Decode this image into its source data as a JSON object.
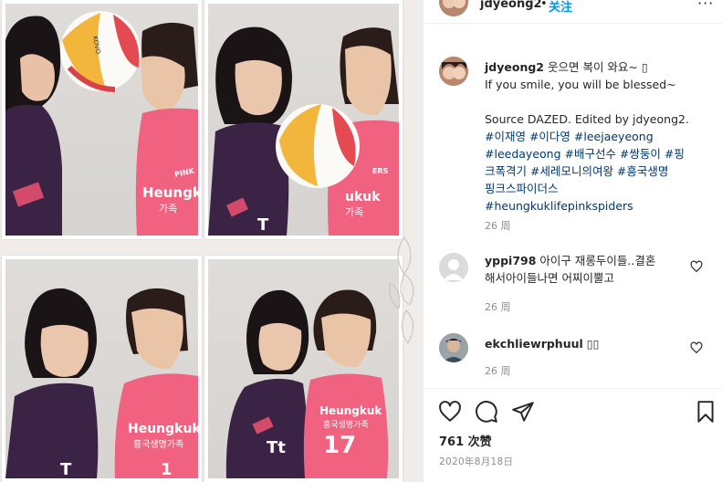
{
  "post": {
    "username": "jdyeong2",
    "separator": "•",
    "follow_label": "关注",
    "more_label": "···"
  },
  "caption": {
    "username": "jdyeong2",
    "line1": "웃으면 복이 와요~ ▯",
    "line2": "If you smile, you will be blessed~",
    "line3": "Source DAZED. Edited by jdyeong2.",
    "hashtags": [
      "#이재영",
      "#이다영",
      "#leejaeyeong",
      "#leedayeong",
      "#배구선수",
      "#쌍둥이",
      "#핑크폭격기",
      "#세레모니의여왕",
      "#흥국생명핑크스파이더스",
      "#heungkuklifepinkspiders"
    ],
    "tag_lines": [
      "#이재영 #이다영 #leejaeyeong",
      "#leedayeong #배구선수 #쌍둥이 #핑",
      "크폭격기 #세레모니의여왕 #흥국생명",
      "핑크스파이더스",
      "#heungkuklifepinkspiders"
    ],
    "time": "26 周"
  },
  "comments": [
    {
      "username": "yppi798",
      "text_line1": "아이구 재롱두이들..결혼",
      "text_line2": "해서아이들나면 어찌이뿔고",
      "time": "26 周"
    },
    {
      "username": "ekchliewrphuul",
      "text": "▯▯",
      "time": "26 周"
    }
  ],
  "footer": {
    "likes": "761 次赞",
    "date": "2020年8月18日"
  },
  "photo_text": {
    "jersey_brand": "Heungkuk",
    "jersey_sub": "흥국생명가족",
    "jersey_logo": "PINK SPIDERS",
    "jersey_number": "17",
    "ball_text": "KOVO"
  },
  "colors": {
    "accent_blue": "#0095f6",
    "hashtag_blue": "#00376b",
    "pink_jersey": "#f0627f",
    "purple_jersey": "#3b2346"
  }
}
